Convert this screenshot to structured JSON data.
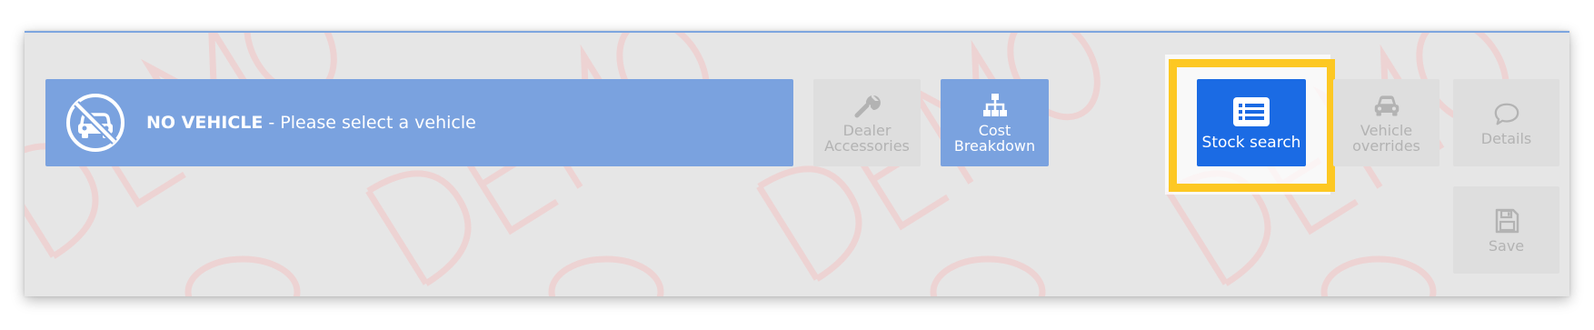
{
  "vehicle_bar": {
    "title": "NO VEHICLE",
    "subtitle": " - Please select a vehicle",
    "icon": "no-vehicle-icon"
  },
  "tiles": {
    "dealer_accessories": {
      "line1": "Dealer",
      "line2": "Accessories",
      "icon": "wrench-icon",
      "enabled": false
    },
    "cost_breakdown": {
      "line1": "Cost",
      "line2": "Breakdown",
      "icon": "sitemap-icon",
      "enabled": true
    },
    "stock_search": {
      "label": "Stock search",
      "icon": "list-icon",
      "enabled": true,
      "highlighted": true
    },
    "vehicle_overrides": {
      "line1": "Vehicle",
      "line2": "overrides",
      "icon": "car-icon",
      "enabled": false
    },
    "details": {
      "label": "Details",
      "icon": "comment-icon",
      "enabled": false
    },
    "save": {
      "label": "Save",
      "icon": "floppy-disk-icon",
      "enabled": false
    }
  },
  "colors": {
    "panel_bg": "#e6e6e6",
    "vehicle_bar_bg": "#7aa2df",
    "primary_button": "#1b6be4",
    "disabled_tile": "#dedede",
    "highlight_border": "#fdc823",
    "watermark": "#f0cccc"
  }
}
